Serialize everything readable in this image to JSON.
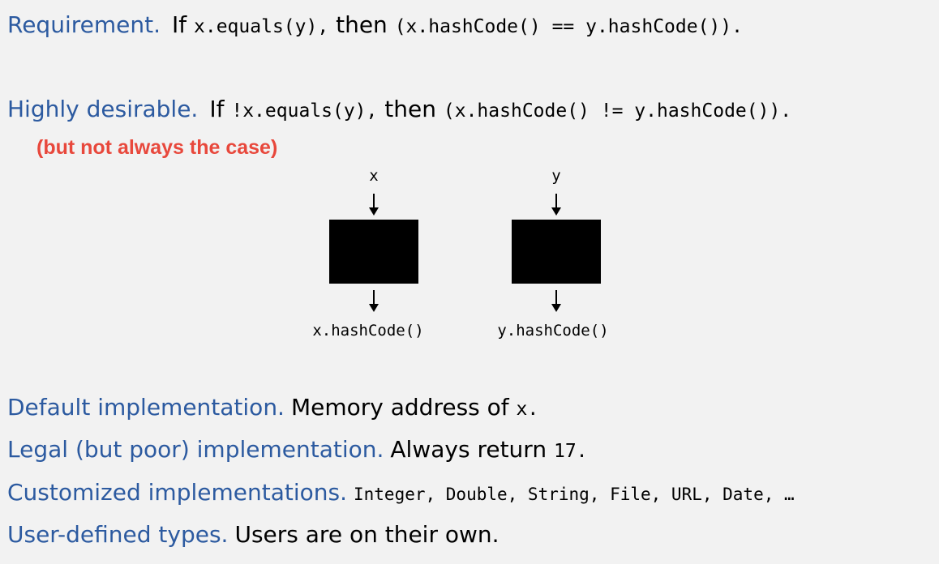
{
  "requirement": {
    "label": "Requirement.",
    "if": "If",
    "cond": "x.equals(y),",
    "then": "then",
    "result": "(x.hashCode() == y.hashCode())."
  },
  "desirable": {
    "label": "Highly desirable.",
    "if": "If",
    "cond": "!x.equals(y),",
    "then": "then",
    "result": "(x.hashCode() != y.hashCode()).",
    "note": "(but not always the case)"
  },
  "diagram": {
    "x_input": "x",
    "y_input": "y",
    "x_output": "x.hashCode()",
    "y_output": "y.hashCode()"
  },
  "default_impl": {
    "label": "Default implementation.",
    "text": "Memory address of",
    "code": "x."
  },
  "legal_impl": {
    "label": "Legal (but poor) implementation.",
    "text": "Always return",
    "code": "17."
  },
  "custom_impl": {
    "label": "Customized implementations.",
    "code": "Integer, Double, String, File, URL, Date, …"
  },
  "user_types": {
    "label": "User-defined types.",
    "text": "Users are on their own."
  }
}
